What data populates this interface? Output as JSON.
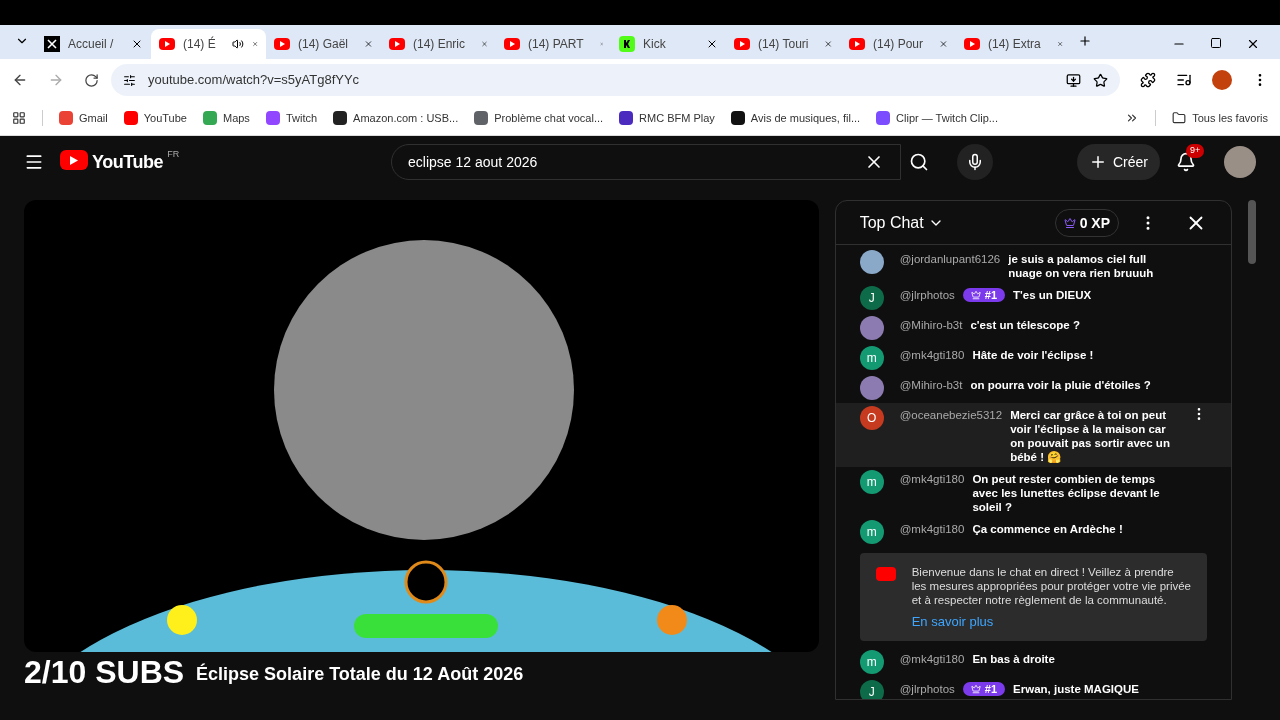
{
  "browser": {
    "tabs": [
      {
        "title": "Accueil / ",
        "kind": "x",
        "selected": false,
        "audio": false
      },
      {
        "title": "(14) É",
        "kind": "video",
        "selected": true,
        "audio": true
      },
      {
        "title": "(14) Gaël",
        "kind": "video",
        "selected": false,
        "audio": false
      },
      {
        "title": "(14) Enric",
        "kind": "video",
        "selected": false,
        "audio": false
      },
      {
        "title": "(14) PART",
        "kind": "video",
        "selected": false,
        "audio": false
      },
      {
        "title": "Kick",
        "kind": "kick",
        "selected": false,
        "audio": false
      },
      {
        "title": "(14) Touri",
        "kind": "video",
        "selected": false,
        "audio": false
      },
      {
        "title": "(14) Pour",
        "kind": "video",
        "selected": false,
        "audio": false
      },
      {
        "title": "(14) Extra",
        "kind": "video",
        "selected": false,
        "audio": false
      }
    ],
    "url": "youtube.com/watch?v=s5yATg8fYYc",
    "bookmarks": [
      {
        "label": "Gmail",
        "color": "#ea4335"
      },
      {
        "label": "YouTube",
        "color": "#ff0000"
      },
      {
        "label": "Maps",
        "color": "#34a853"
      },
      {
        "label": "Twitch",
        "color": "#9146ff"
      },
      {
        "label": "Amazon.com : USB...",
        "color": "#222222"
      },
      {
        "label": "Problème chat vocal...",
        "color": "#5f6368"
      },
      {
        "label": "RMC BFM Play",
        "color": "#4b2bbf"
      },
      {
        "label": "Avis de musiques, fil...",
        "color": "#111111"
      },
      {
        "label": "Clipr — Twitch Clip...",
        "color": "#7c4dff"
      }
    ],
    "all_bookmarks": "Tous les favoris"
  },
  "youtube": {
    "logo_text": "YouTube",
    "country": "FR",
    "search": {
      "value": "eclipse 12 aout 2026"
    },
    "create_label": "Créer",
    "notifications": "9+"
  },
  "video": {
    "overlay": "2/10 SUBS",
    "title": "Éclipse Solaire Totale du 12 Août 2026"
  },
  "chat": {
    "mode": "Top Chat",
    "xp": "0 XP",
    "messages": [
      {
        "kind": "message",
        "author": "@jordanlupant6126",
        "text": "je suis a palamos ciel full nuage on vera rien bruuuh",
        "color": "#8aa9c9",
        "hovered": false
      },
      {
        "kind": "message",
        "author": "@jlrphotos",
        "avatar": "J",
        "color": "#0d6b4a",
        "badge": "#1",
        "text": "T'es un DIEUX",
        "hovered": false
      },
      {
        "kind": "message",
        "author": "@Mihiro-b3t",
        "text": "c'est un télescope ?",
        "color": "#8c7bb0",
        "hovered": false
      },
      {
        "kind": "message",
        "author": "@mk4gti180",
        "avatar": "m",
        "color": "#139a73",
        "text": "Hâte de voir l'éclipse !",
        "hovered": false
      },
      {
        "kind": "message",
        "author": "@Mihiro-b3t",
        "text": "on pourra voir la pluie d'étoiles ?",
        "color": "#8c7bb0",
        "hovered": false
      },
      {
        "kind": "message",
        "author": "@oceanebezie5312",
        "avatar": "O",
        "color": "#c63a1f",
        "text": "Merci car grâce à toi on peut voir l'éclipse à la maison car on pouvait pas sortir avec un bébé ! 🤗",
        "hovered": true
      },
      {
        "kind": "message",
        "author": "@mk4gti180",
        "avatar": "m",
        "color": "#139a73",
        "text": "On peut rester combien de temps avec les lunettes éclipse devant le soleil ?",
        "hovered": false
      },
      {
        "kind": "message",
        "author": "@mk4gti180",
        "avatar": "m",
        "color": "#139a73",
        "text": "Ça commence en Ardèche !",
        "hovered": false
      },
      {
        "kind": "notice",
        "text": "Bienvenue dans le chat en direct ! Veillez à prendre les mesures appropriées pour protéger votre vie privée et à respecter notre règlement de la communauté.",
        "link": "En savoir plus"
      },
      {
        "kind": "message",
        "author": "@mk4gti180",
        "avatar": "m",
        "color": "#139a73",
        "text": "En bas à droite",
        "hovered": false
      },
      {
        "kind": "message",
        "author": "@jlrphotos",
        "avatar": "J",
        "color": "#0d6b4a",
        "badge": "#1",
        "text": "Erwan, juste MAGIQUE",
        "hovered": false
      }
    ]
  }
}
